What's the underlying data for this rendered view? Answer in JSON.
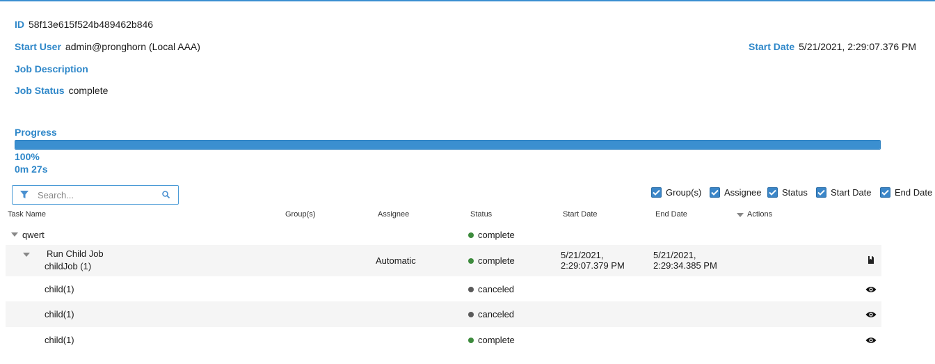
{
  "job": {
    "id_label": "ID",
    "id_value": "58f13e615f524b489462b846",
    "start_user_label": "Start User",
    "start_user_value": "admin@pronghorn (Local AAA)",
    "start_date_label": "Start Date",
    "start_date_value": "5/21/2021, 2:29:07.376 PM",
    "description_label": "Job Description",
    "status_label": "Job Status",
    "status_value": "complete"
  },
  "progress": {
    "label": "Progress",
    "fraction": 1.0,
    "percent_text": "100%",
    "elapsed_text": "0m 27s"
  },
  "search": {
    "placeholder": "Search..."
  },
  "column_toggles": [
    {
      "label": "Group(s)",
      "checked": true
    },
    {
      "label": "Assignee",
      "checked": true
    },
    {
      "label": "Status",
      "checked": true
    },
    {
      "label": "Start Date",
      "checked": true
    },
    {
      "label": "End Date",
      "checked": true
    }
  ],
  "table": {
    "headers": {
      "task_name": "Task Name",
      "groups": "Group(s)",
      "assignee": "Assignee",
      "status": "Status",
      "start_date": "Start Date",
      "end_date": "End Date",
      "actions": "Actions"
    },
    "rows": [
      {
        "name": "qwert",
        "status": "complete"
      },
      {
        "name_line1": "Run Child Job",
        "name_line2": "childJob (1)",
        "assignee": "Automatic",
        "status": "complete",
        "start_line1": "5/21/2021,",
        "start_line2": "2:29:07.379 PM",
        "end_line1": "5/21/2021,",
        "end_line2": "2:29:34.385 PM"
      },
      {
        "name": "child(1)",
        "status": "canceled"
      },
      {
        "name": "child(1)",
        "status": "canceled"
      },
      {
        "name": "child(1)",
        "status": "complete"
      }
    ]
  },
  "colors": {
    "accent": "#2e87c9",
    "status_complete": "#3d8b3d",
    "status_canceled": "#5a5a5a"
  }
}
